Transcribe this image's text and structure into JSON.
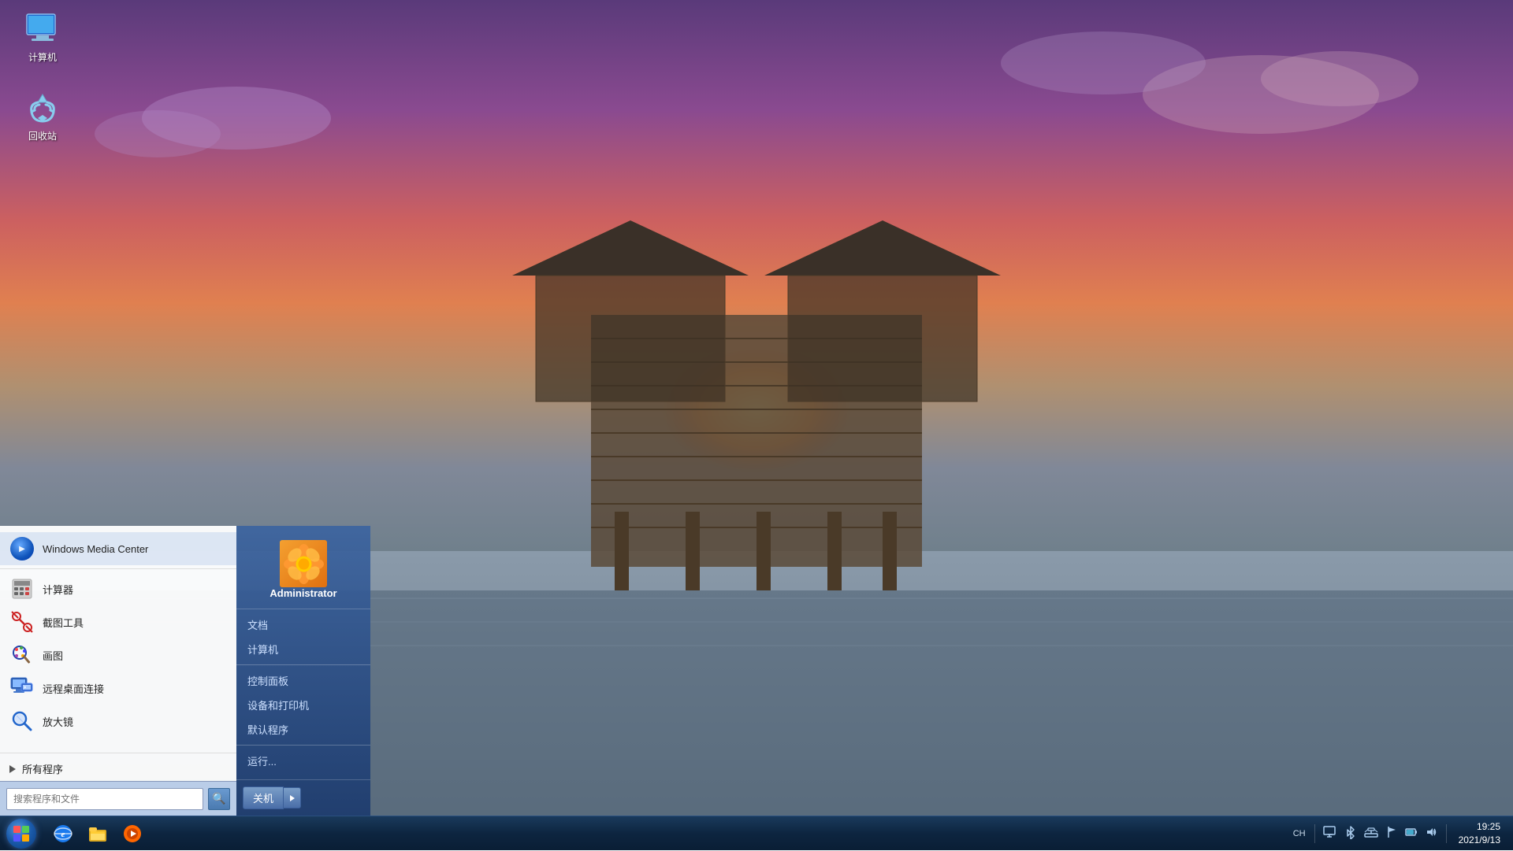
{
  "desktop": {
    "background_desc": "sunset pier over calm water with purple sky",
    "icons": [
      {
        "id": "computer",
        "label": "计算机",
        "type": "computer"
      },
      {
        "id": "recycle",
        "label": "回收站",
        "type": "recycle"
      }
    ]
  },
  "start_menu": {
    "user": {
      "name": "Administrator",
      "avatar_type": "flower"
    },
    "left_apps": [
      {
        "id": "wmc",
        "label": "Windows Media Center",
        "icon_type": "wmc"
      },
      {
        "id": "calc",
        "label": "计算器",
        "icon_type": "calc"
      },
      {
        "id": "snip",
        "label": "截图工具",
        "icon_type": "scissors"
      },
      {
        "id": "paint",
        "label": "画图",
        "icon_type": "paint"
      },
      {
        "id": "rdp",
        "label": "远程桌面连接",
        "icon_type": "rdp"
      },
      {
        "id": "magnifier",
        "label": "放大镜",
        "icon_type": "magnifier"
      }
    ],
    "right_items": [
      {
        "id": "documents",
        "label": "文档"
      },
      {
        "id": "computer",
        "label": "计算机"
      },
      {
        "id": "control_panel",
        "label": "控制面板"
      },
      {
        "id": "devices_printers",
        "label": "设备和打印机"
      },
      {
        "id": "default_programs",
        "label": "默认程序"
      },
      {
        "id": "run",
        "label": "运行..."
      }
    ],
    "all_programs_label": "所有程序",
    "search_placeholder": "搜索程序和文件",
    "shutdown_label": "关机"
  },
  "taskbar": {
    "pinned": [
      {
        "id": "start",
        "type": "start"
      },
      {
        "id": "ie",
        "type": "ie",
        "tooltip": "Internet Explorer"
      },
      {
        "id": "explorer",
        "type": "explorer",
        "tooltip": "Windows资源管理器"
      },
      {
        "id": "wmp",
        "type": "wmp",
        "tooltip": "Windows Media Player"
      }
    ],
    "tray": {
      "lang": "CH",
      "time": "19:25",
      "date": "2021/9/13",
      "icons": [
        "input",
        "screen",
        "bluetooth",
        "network",
        "flag",
        "battery",
        "volume"
      ]
    }
  }
}
